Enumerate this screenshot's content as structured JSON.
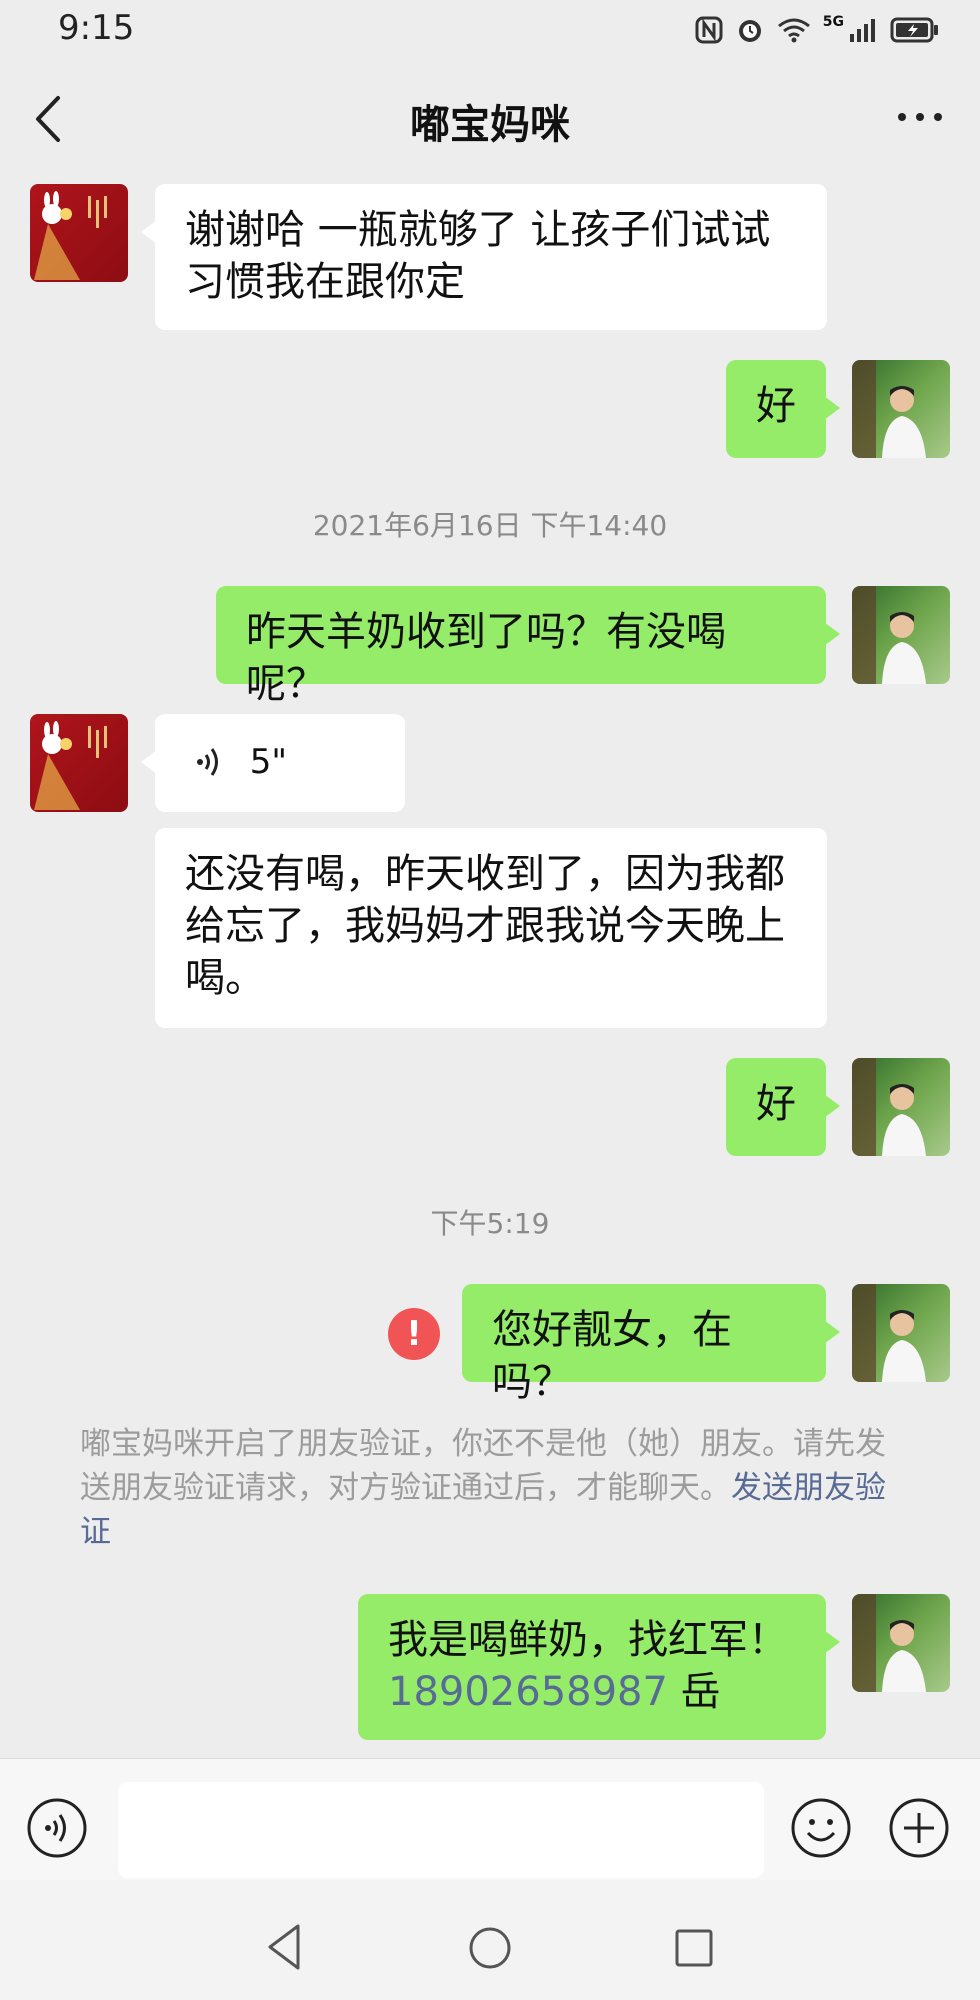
{
  "status_bar": {
    "time": "9:15",
    "network": "5G"
  },
  "header": {
    "title": "嘟宝妈咪"
  },
  "messages": [
    {
      "side": "left",
      "text": "谢谢哈 一瓶就够了 让孩子们试试\n习惯我在跟你定"
    },
    {
      "side": "right",
      "text": "好"
    },
    {
      "type": "timestamp",
      "text": "2021年6月16日 下午14:40"
    },
    {
      "side": "right",
      "text": "昨天羊奶收到了吗？有没喝呢？"
    },
    {
      "side": "left",
      "type": "voice",
      "duration": "5\""
    },
    {
      "side": "left",
      "text": "还没有喝，昨天收到了，因为我都\n给忘了，我妈妈才跟我说今天晚上\n喝。"
    },
    {
      "side": "right",
      "text": "好"
    },
    {
      "type": "timestamp",
      "text": "下午5:19"
    },
    {
      "side": "right",
      "text": "您好靓女，在吗？",
      "error": true
    },
    {
      "side": "right",
      "text": "我是喝鲜奶，找红军！",
      "phone": "18902658987",
      "suffix": " 岳"
    }
  ],
  "system_note": {
    "text": "嘟宝妈咪开启了朋友验证，你还不是他（她）朋友。请先发送朋友验证请求，对方验证通过后，才能聊天。",
    "link": "发送朋友验证"
  },
  "input": {
    "placeholder": ""
  },
  "colors": {
    "background": "#ededed",
    "sent_bubble": "#95ec69",
    "received_bubble": "#ffffff",
    "link": "#576b95",
    "error": "#f05454"
  }
}
